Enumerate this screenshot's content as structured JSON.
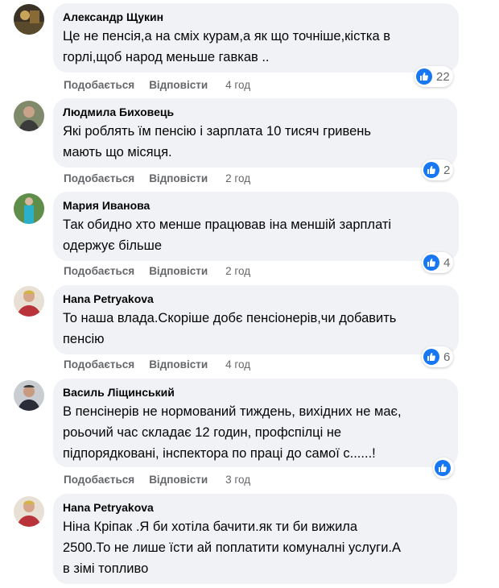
{
  "actions": {
    "like": "Подобається",
    "reply": "Відповісти"
  },
  "colors": {
    "bubble": "#f0f2f5",
    "like_blue": "#1877f2",
    "meta_gray": "#65676b"
  },
  "comments": [
    {
      "author": "Александр Щукин",
      "lines": [
        "Це не пенсія,а на сміх курам,а як що точніше,кістка в",
        "горлі,щоб народ меньше гавкав .."
      ],
      "time": "4 год",
      "reactions": "22"
    },
    {
      "author": "Людмила Биховець",
      "lines": [
        "Які роблять їм пенсію і зарплата 10 тисяч гривень",
        "мають що місяця."
      ],
      "time": "2 год",
      "reactions": "2"
    },
    {
      "author": "Мария Иванова",
      "lines": [
        "Так обидно хто менше працював іна меншій зарплаті",
        "одержує більше"
      ],
      "time": "2 год",
      "reactions": "4"
    },
    {
      "author": "Hana Petryakova",
      "lines": [
        "То наша влада.Скоріше добє пенсіонерів,чи добавить",
        "пенсію"
      ],
      "time": "4 год",
      "reactions": "6"
    },
    {
      "author": "Василь Ліщинський",
      "lines": [
        "В пенсінерів не нормований тиждень, вихідних не має,",
        "роьочий час складає 12 годин, профспілці не",
        "підпорядковані, інспектора по праці до самої с......!"
      ],
      "time": "3 год",
      "reactions": ""
    },
    {
      "author": "Hana Petryakova",
      "lines": [
        "Ніна Кріпак .Я би хотіла бачити.як ти би вижила",
        "2500.То не лише їсти ай поплатити комуналні услуги.А",
        "в зімі топливо"
      ],
      "time": "",
      "reactions": ""
    }
  ]
}
